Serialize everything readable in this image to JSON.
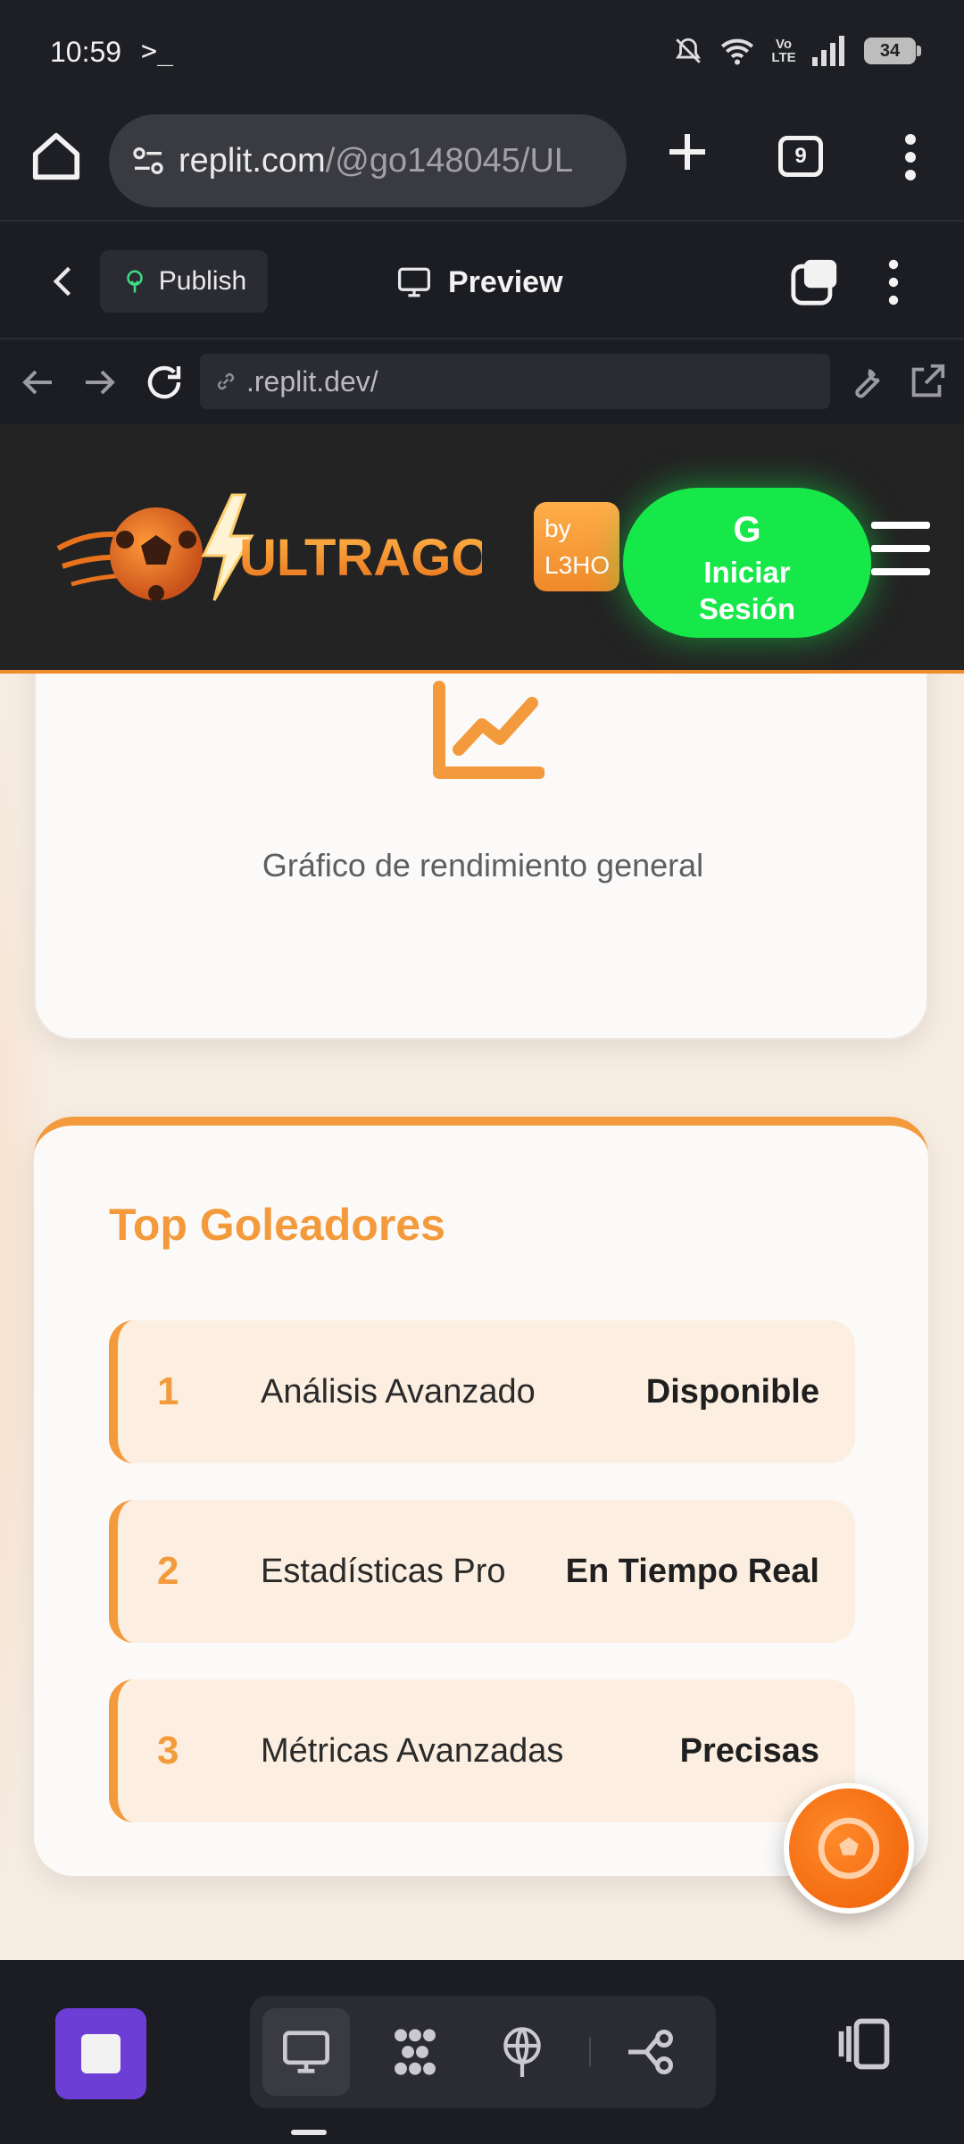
{
  "status_bar": {
    "time": "10:59",
    "terminal_glyph": ">_",
    "battery": "34",
    "network": "Vo LTE"
  },
  "browser": {
    "url_host": "replit.com",
    "url_path": "/@go148045/UL",
    "tab_count": "9"
  },
  "replit": {
    "publish_label": "Publish",
    "preview_label": "Preview",
    "preview_url": ".replit.dev/"
  },
  "site": {
    "logo_text": "ULTRAGOL",
    "by_line1": "by",
    "by_line2": "L3HO",
    "login_icon": "G",
    "login_line1": "Iniciar",
    "login_line2": "Sesión",
    "chart_caption": "Gráfico de rendimiento general",
    "scorers_title": "Top Goleadores",
    "scorers": [
      {
        "rank": "1",
        "name": "Análisis Avanzado",
        "status": "Disponible"
      },
      {
        "rank": "2",
        "name": "Estadísticas Pro",
        "status": "En Tiempo Real"
      },
      {
        "rank": "3",
        "name": "Métricas Avanzadas",
        "status": "Precisas"
      }
    ]
  },
  "colors": {
    "accent_orange": "#f39b3c",
    "login_green": "#16e84a",
    "stop_purple": "#6c3ed6"
  }
}
